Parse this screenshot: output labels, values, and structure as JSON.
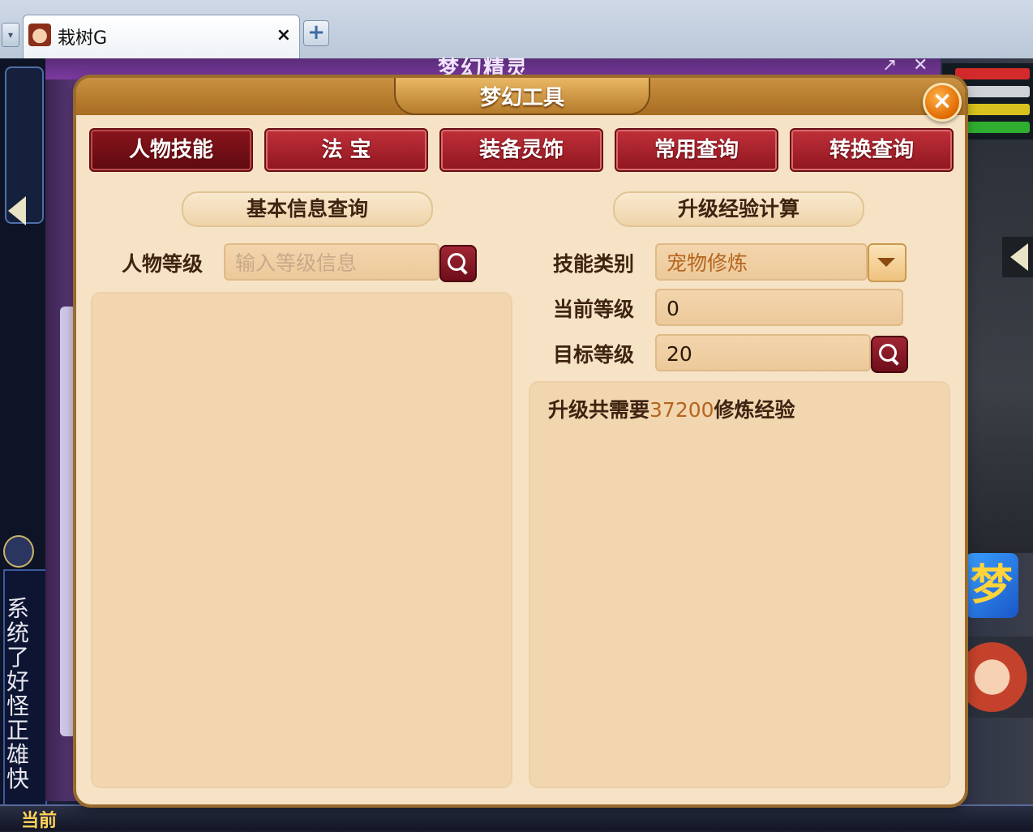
{
  "browser": {
    "tab_title": "栽树G",
    "tab_close": "×",
    "new_tab": "+"
  },
  "game": {
    "outer_window_title": "梦幻精灵",
    "bottom_label": "当前",
    "chat_text": "系统 了好 怪正 雄快",
    "logo_text": "梦"
  },
  "tool": {
    "title": "梦幻工具",
    "close_glyph": "×",
    "tabs": [
      {
        "label": "人物技能",
        "active": true
      },
      {
        "label": "法 宝",
        "active": false
      },
      {
        "label": "装备灵饰",
        "active": false
      },
      {
        "label": "常用查询",
        "active": false
      },
      {
        "label": "转换查询",
        "active": false
      }
    ],
    "left": {
      "section_title": "基本信息查询",
      "level_label": "人物等级",
      "level_placeholder": "输入等级信息",
      "level_value": ""
    },
    "right": {
      "section_title": "升级经验计算",
      "skill_type_label": "技能类别",
      "skill_type_value": "宠物修炼",
      "current_level_label": "当前等级",
      "current_level_value": "0",
      "target_level_label": "目标等级",
      "target_level_value": "20",
      "result_prefix": "升级共需要",
      "result_value": "37200",
      "result_suffix": "修炼经验"
    }
  },
  "colors": {
    "tab_red": "#a01f2a",
    "panel_bg": "#f6e3c6",
    "accent_orange": "#e06a00",
    "result_value": "#b5651d"
  },
  "icons": [
    "search-icon",
    "chevron-down-icon",
    "close-icon",
    "left-arrow-icon"
  ]
}
